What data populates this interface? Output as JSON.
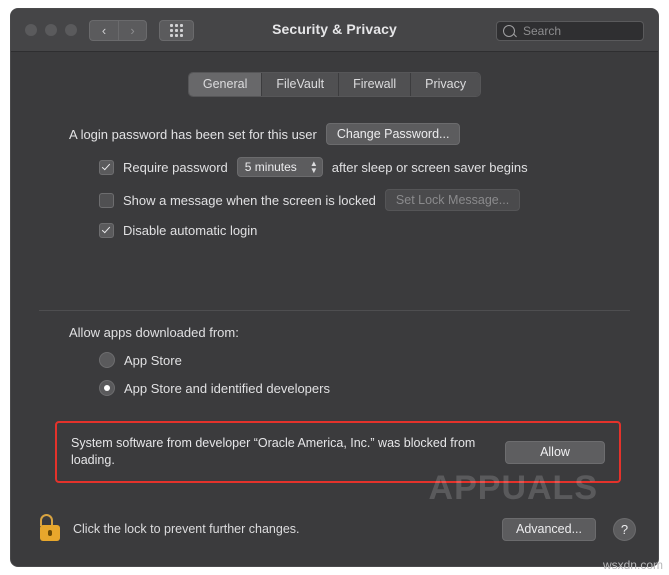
{
  "window": {
    "title": "Security & Privacy",
    "nav": {
      "back": "‹",
      "forward": "›",
      "grid_icon": "grid-icon"
    },
    "search": {
      "placeholder": "Search",
      "value": "",
      "icon": "search-icon"
    }
  },
  "tabs": [
    {
      "label": "General",
      "active": true
    },
    {
      "label": "FileVault",
      "active": false
    },
    {
      "label": "Firewall",
      "active": false
    },
    {
      "label": "Privacy",
      "active": false
    }
  ],
  "general": {
    "login_password_text": "A login password has been set for this user",
    "change_password_button": "Change Password...",
    "require_password": {
      "label_prefix": "Require password",
      "checked": true,
      "interval": "5 minutes",
      "label_suffix": "after sleep or screen saver begins"
    },
    "lock_message": {
      "label": "Show a message when the screen is locked",
      "checked": false,
      "button": "Set Lock Message..."
    },
    "disable_auto_login": {
      "label": "Disable automatic login",
      "checked": true
    }
  },
  "allow_apps": {
    "title": "Allow apps downloaded from:",
    "options": [
      {
        "label": "App Store",
        "selected": false
      },
      {
        "label": "App Store and identified developers",
        "selected": true
      }
    ]
  },
  "alert": {
    "message": "System software from developer “Oracle America, Inc.” was blocked from loading.",
    "button": "Allow",
    "border_color": "#e4322b"
  },
  "footer": {
    "lock_icon": "lock-icon",
    "lock_text": "Click the lock to prevent further changes.",
    "advanced_button": "Advanced...",
    "help_button": "?"
  },
  "watermarks": {
    "brand": "APPUALS",
    "corner": "wsxdn.com"
  }
}
